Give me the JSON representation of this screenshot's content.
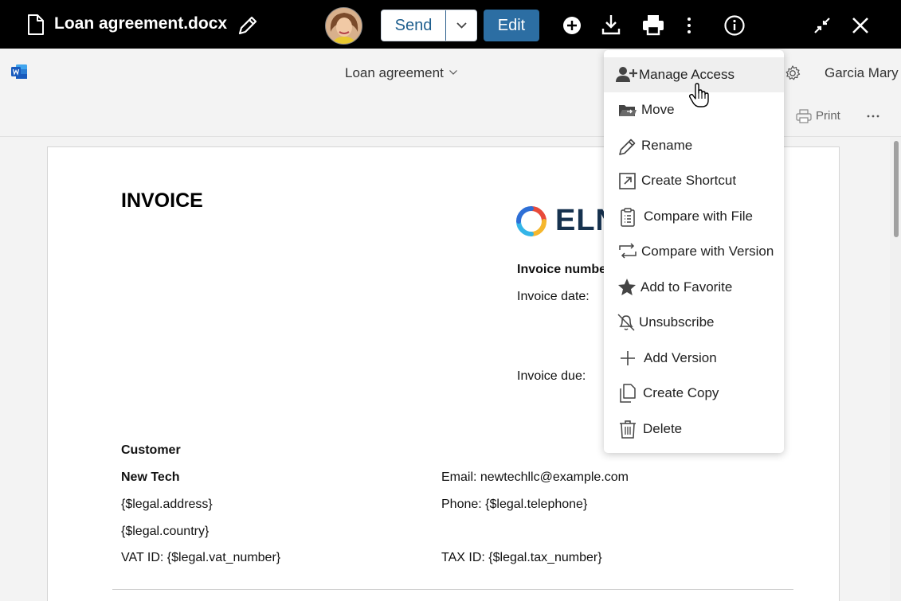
{
  "topbar": {
    "file_name": "Loan agreement.docx",
    "send_label": "Send",
    "edit_label": "Edit"
  },
  "word_header": {
    "doc_name": "Loan agreement",
    "user_name": "Garcia Mary",
    "print_label": "Print"
  },
  "document": {
    "title": "INVOICE",
    "logo_text": "ELN",
    "invoice_number_label": "Invoice numbe",
    "invoice_date_label": "Invoice date:",
    "invoice_due_label": "Invoice due:",
    "customer_heading": "Customer",
    "customer_name": "New Tech",
    "address": "{$legal.address}",
    "country": "{$legal.country}",
    "vat_prefix": "VAT ID: ",
    "vat_value": "{$legal.vat_number}",
    "email_prefix": "Email: ",
    "email_value": "newtechllc@example.com",
    "phone_prefix": "Phone: ",
    "phone_value": "{$legal.telephone}",
    "tax_prefix": "TAX ID: ",
    "tax_value": "{$legal.tax_number}"
  },
  "menu": {
    "items": [
      {
        "label": "Manage Access",
        "icon": "user-plus-icon"
      },
      {
        "label": "Move",
        "icon": "folder-move-icon"
      },
      {
        "label": "Rename",
        "icon": "pencil-icon"
      },
      {
        "label": "Create Shortcut",
        "icon": "shortcut-arrow-icon"
      },
      {
        "label": "Compare with File",
        "icon": "clipboard-icon"
      },
      {
        "label": "Compare with Version",
        "icon": "swap-arrows-icon"
      },
      {
        "label": "Add to Favorite",
        "icon": "star-icon"
      },
      {
        "label": "Unsubscribe",
        "icon": "bell-off-icon"
      },
      {
        "label": "Add Version",
        "icon": "plus-icon"
      },
      {
        "label": "Create Copy",
        "icon": "copy-icon"
      },
      {
        "label": "Delete",
        "icon": "trash-icon"
      }
    ]
  },
  "colors": {
    "topbar_bg": "#000000",
    "edit_button": "#2c6ea3",
    "send_text": "#1f5f8e",
    "menu_hover": "#efefef"
  }
}
